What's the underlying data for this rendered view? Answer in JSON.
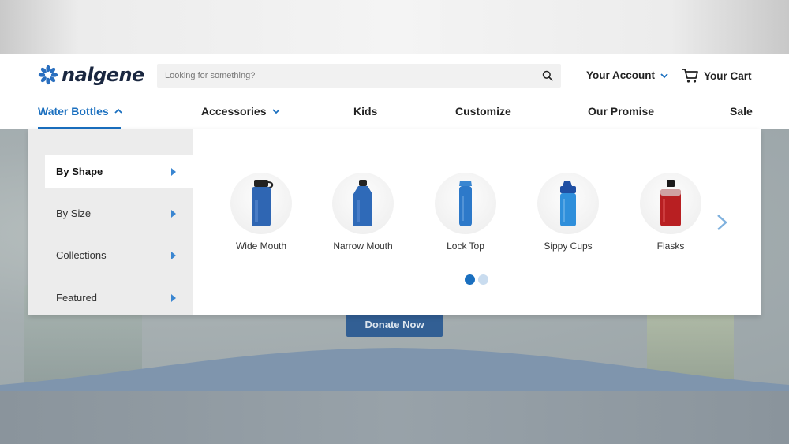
{
  "brand": {
    "name": "nalgene"
  },
  "search": {
    "placeholder": "Looking for something?"
  },
  "header": {
    "account_label": "Your Account",
    "cart_label": "Your Cart"
  },
  "nav": [
    {
      "label": "Water Bottles"
    },
    {
      "label": "Accessories"
    },
    {
      "label": "Kids"
    },
    {
      "label": "Customize"
    },
    {
      "label": "Our Promise"
    },
    {
      "label": "Sale"
    }
  ],
  "menu": {
    "categories": [
      {
        "label": "By Shape"
      },
      {
        "label": "By Size"
      },
      {
        "label": "Collections"
      },
      {
        "label": "Featured"
      }
    ],
    "products": [
      {
        "label": "Wide Mouth",
        "icon": "wide-mouth-bottle-icon",
        "color": "#2f66b3"
      },
      {
        "label": "Narrow Mouth",
        "icon": "narrow-mouth-bottle-icon",
        "color": "#2f6ab8"
      },
      {
        "label": "Lock Top",
        "icon": "lock-top-bottle-icon",
        "color": "#2d79c9"
      },
      {
        "label": "Sippy Cups",
        "icon": "sippy-cup-icon",
        "color": "#2f8fdb"
      },
      {
        "label": "Flasks",
        "icon": "flask-icon",
        "color": "#b81f22"
      }
    ],
    "carousel_pages": 2,
    "carousel_active": 1
  },
  "hero": {
    "donate_label": "Donate Now"
  },
  "colors": {
    "accent": "#1a6fbf",
    "text": "#222222"
  }
}
